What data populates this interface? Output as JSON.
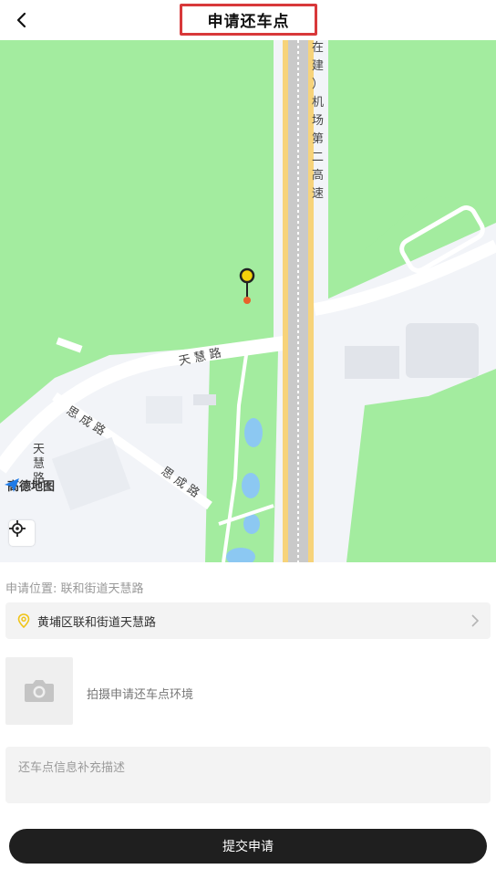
{
  "header": {
    "title": "申请还车点"
  },
  "map": {
    "road_labels": {
      "expressway": [
        "在",
        "建",
        "）",
        "机",
        "场",
        "第",
        "二",
        "高",
        "速"
      ],
      "tianhui_road": "天 慧 路",
      "sicheng_road_1": "思 成 路",
      "sicheng_road_2": "思 成 路",
      "tianhui_vertical": [
        "天",
        "慧",
        "路"
      ]
    },
    "provider": "高德地图"
  },
  "form": {
    "location_label": "申请位置: 联和街道天慧路",
    "address": "黄埔区联和街道天慧路",
    "photo_hint": "拍摄申请还车点环境",
    "description_placeholder": "还车点信息补充描述",
    "submit_label": "提交申请"
  },
  "colors": {
    "accent_red": "#d8383a",
    "pin_yellow": "#f5d20a",
    "map_green": "#a3ec9f"
  }
}
